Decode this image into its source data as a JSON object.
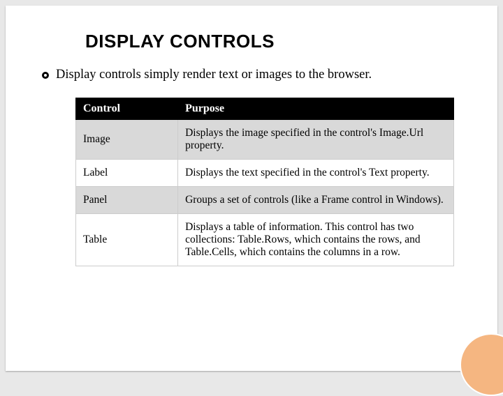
{
  "title": "DISPLAY CONTROLS",
  "intro": "Display controls simply render text or images to the browser.",
  "headers": {
    "control": "Control",
    "purpose": "Purpose"
  },
  "rows": [
    {
      "control": "Image",
      "purpose": "Displays the image specified in the control's Image.Url property."
    },
    {
      "control": "Label",
      "purpose": "Displays the text specified in the control's Text property."
    },
    {
      "control": "Panel",
      "purpose": "Groups a set of controls (like a Frame control in Windows)."
    },
    {
      "control": "Table",
      "purpose": "Displays a table of information. This control has two collections: Table.Rows, which contains the rows, and Table.Cells, which contains the columns in a row."
    }
  ],
  "chart_data": {
    "type": "table",
    "title": "DISPLAY CONTROLS",
    "columns": [
      "Control",
      "Purpose"
    ],
    "rows": [
      [
        "Image",
        "Displays the image specified in the control's Image.Url property."
      ],
      [
        "Label",
        "Displays the text specified in the control's Text property."
      ],
      [
        "Panel",
        "Groups a set of controls (like a Frame control in Windows)."
      ],
      [
        "Table",
        "Displays a table of information. This control has two collections: Table.Rows, which contains the rows, and Table.Cells, which contains the columns in a row."
      ]
    ]
  }
}
